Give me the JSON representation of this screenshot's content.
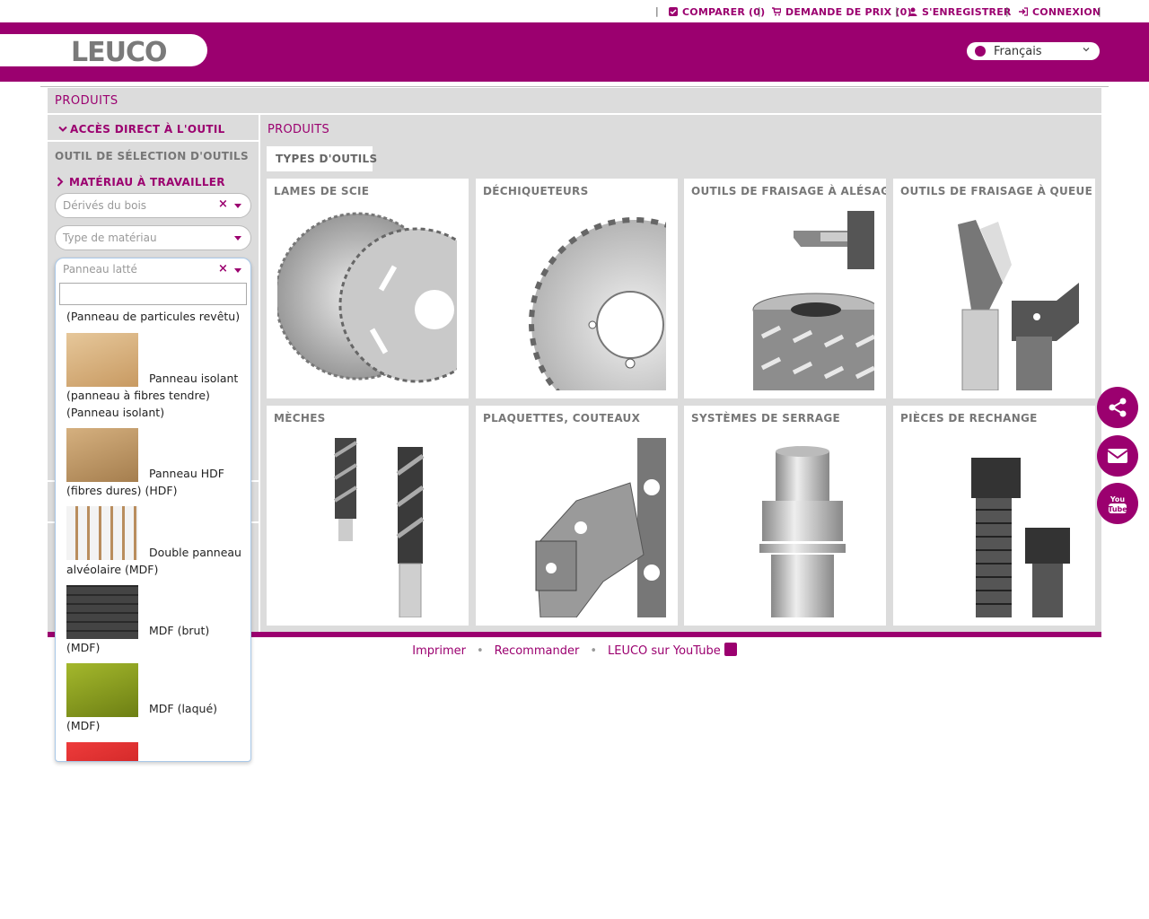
{
  "topbar": {
    "compare": "COMPARER (0)",
    "quote": "DEMANDE DE PRIX (0)",
    "register": "S'ENREGISTRER",
    "login": "CONNEXION"
  },
  "header": {
    "logo": "LEUCO",
    "language": "Français"
  },
  "page": {
    "title": "PRODUITS"
  },
  "sidebar": {
    "direct_access": "ACCÈS DIRECT À L'OUTIL",
    "selector_title": "OUTIL DE SÉLECTION D'OUTILS",
    "material_title": "MATÉRIAU À TRAVAILLER",
    "select1_value": "Dérivés du bois",
    "select2_placeholder": "Type de matériau",
    "select3_value": "Panneau latté",
    "dropdown": {
      "first_option": "(Panneau de particules revêtu)",
      "options": [
        {
          "label": "Panneau isolant (panneau à fibres tendre) (Panneau isolant)",
          "icon": "insulation-board-icon"
        },
        {
          "label": "Panneau HDF (fibres dures) (HDF)",
          "icon": "hdf-board-icon"
        },
        {
          "label": "Double panneau alvéolaire (MDF)",
          "icon": "honeycomb-board-icon"
        },
        {
          "label": "MDF (brut) (MDF)",
          "icon": "mdf-raw-icon"
        },
        {
          "label": "MDF (laqué) (MDF)",
          "icon": "mdf-lacquered-icon"
        }
      ]
    }
  },
  "content": {
    "breadcrumb": "PRODUITS",
    "tab": "TYPES D'OUTILS",
    "cards": [
      {
        "title": "LAMES DE SCIE"
      },
      {
        "title": "DÉCHIQUETEURS"
      },
      {
        "title": "OUTILS DE FRAISAGE À ALÉSAGE"
      },
      {
        "title": "OUTILS DE FRAISAGE À QUEUE"
      },
      {
        "title": "MÈCHES"
      },
      {
        "title": "PLAQUETTES, COUTEAUX"
      },
      {
        "title": "SYSTÈMES DE SERRAGE"
      },
      {
        "title": "PIÈCES DE RECHANGE"
      }
    ]
  },
  "footer": {
    "print": "Imprimer",
    "recommend": "Recommander",
    "youtube": "LEUCO sur YouTube"
  },
  "colors": {
    "brand": "#9b006f",
    "panel": "#dcdcdc"
  }
}
